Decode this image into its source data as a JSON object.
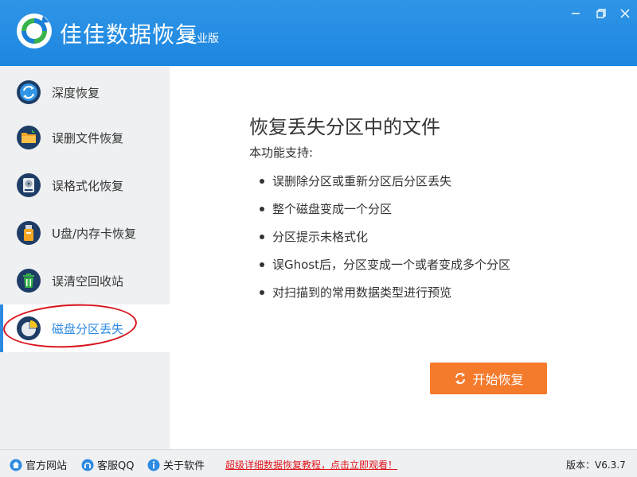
{
  "app": {
    "title": "佳佳数据恢复",
    "edition": "专业版"
  },
  "sidebar": {
    "items": [
      {
        "label": "深度恢复",
        "icon": "deep-recovery-icon"
      },
      {
        "label": "误删文件恢复",
        "icon": "folder-icon"
      },
      {
        "label": "误格式化恢复",
        "icon": "hard-disk-icon"
      },
      {
        "label": "U盘/内存卡恢复",
        "icon": "usb-icon"
      },
      {
        "label": "误清空回收站",
        "icon": "recycle-bin-icon"
      },
      {
        "label": "磁盘分区丢失",
        "icon": "pie-chart-icon",
        "active": true
      }
    ]
  },
  "main": {
    "title": "恢复丢失分区中的文件",
    "support_label": "本功能支持:",
    "features": [
      "误删除分区或重新分区后分区丢失",
      "整个磁盘变成一个分区",
      "分区提示未格式化",
      "误Ghost后，分区变成一个或者变成多个分区",
      "对扫描到的常用数据类型进行预览"
    ],
    "start_button": "开始恢复"
  },
  "statusbar": {
    "website": "官方网站",
    "support_qq": "客服QQ",
    "about": "关于软件",
    "promo": "超级详细数据恢复教程，点击立即观看！",
    "version": "版本：V6.3.7"
  },
  "colors": {
    "titlebar": "#1d86e0",
    "accent": "#2c8ae0",
    "start_button": "#f47a2c",
    "promo": "#e0141b",
    "annotation": "#d8141c"
  }
}
